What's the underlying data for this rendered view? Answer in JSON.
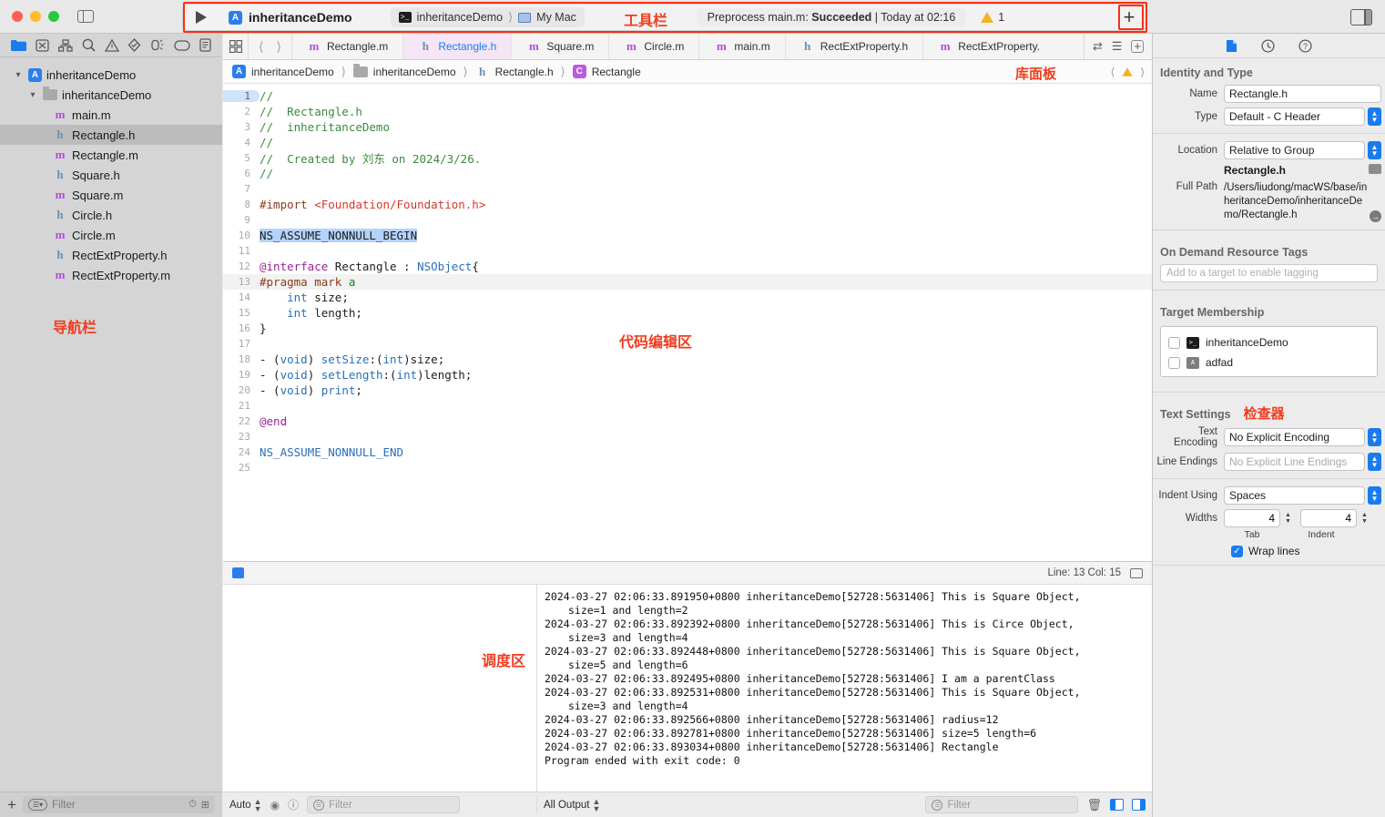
{
  "window": {
    "traffic_lights": [
      "close",
      "minimize",
      "zoom"
    ],
    "sidebar_toggle": "toggle-navigator"
  },
  "toolbar": {
    "run_button": "run",
    "scheme_name": "inheritanceDemo",
    "destination_project": "inheritanceDemo",
    "destination_device": "My Mac",
    "status_text_prefix": "Preprocess main.m: ",
    "status_result": "Succeeded",
    "status_text_suffix": " | Today at 02:16",
    "warning_count": "1",
    "add_button": "+",
    "annotation": "工具栏"
  },
  "navigator": {
    "tabs": [
      "project-navigator",
      "source-control-navigator",
      "hierarchy-navigator",
      "find-navigator",
      "issue-navigator",
      "test-navigator",
      "debug-navigator",
      "breakpoint-navigator",
      "report-navigator"
    ],
    "annotation": "导航栏",
    "tree": [
      {
        "label": "inheritanceDemo",
        "kind": "project",
        "depth": 0,
        "expanded": true,
        "selected": false
      },
      {
        "label": "inheritanceDemo",
        "kind": "folder",
        "depth": 1,
        "expanded": true,
        "selected": false
      },
      {
        "label": "main.m",
        "kind": "m",
        "depth": 2,
        "selected": false
      },
      {
        "label": "Rectangle.h",
        "kind": "h",
        "depth": 2,
        "selected": true
      },
      {
        "label": "Rectangle.m",
        "kind": "m",
        "depth": 2,
        "selected": false
      },
      {
        "label": "Square.h",
        "kind": "h",
        "depth": 2,
        "selected": false
      },
      {
        "label": "Square.m",
        "kind": "m",
        "depth": 2,
        "selected": false
      },
      {
        "label": "Circle.h",
        "kind": "h",
        "depth": 2,
        "selected": false
      },
      {
        "label": "Circle.m",
        "kind": "m",
        "depth": 2,
        "selected": false
      },
      {
        "label": "RectExtProperty.h",
        "kind": "h",
        "depth": 2,
        "selected": false
      },
      {
        "label": "RectExtProperty.m",
        "kind": "m",
        "depth": 2,
        "selected": false
      }
    ],
    "bottom": {
      "add_label": "+",
      "filter_placeholder": "Filter"
    }
  },
  "editor": {
    "tabs": [
      {
        "label": "Rectangle.m",
        "kind": "m",
        "active": false
      },
      {
        "label": "Rectangle.h",
        "kind": "h",
        "active": true
      },
      {
        "label": "Square.m",
        "kind": "m",
        "active": false
      },
      {
        "label": "Circle.m",
        "kind": "m",
        "active": false
      },
      {
        "label": "main.m",
        "kind": "m",
        "active": false
      },
      {
        "label": "RectExtProperty.h",
        "kind": "h",
        "active": false
      },
      {
        "label": "RectExtProperty.",
        "kind": "m",
        "active": false
      }
    ],
    "breadcrumb": [
      {
        "label": "inheritanceDemo",
        "kind": "project"
      },
      {
        "label": "inheritanceDemo",
        "kind": "folder"
      },
      {
        "label": "Rectangle.h",
        "kind": "h"
      },
      {
        "label": "Rectangle",
        "kind": "class"
      }
    ],
    "library_annotation": "库面板",
    "code_annotation": "代码编辑区",
    "lines": [
      {
        "n": "1",
        "cur": true,
        "html": "<span class='c-com'>//</span>"
      },
      {
        "n": "2",
        "html": "<span class='c-com'>//  Rectangle.h</span>"
      },
      {
        "n": "3",
        "html": "<span class='c-com'>//  inheritanceDemo</span>"
      },
      {
        "n": "4",
        "html": "<span class='c-com'>//</span>"
      },
      {
        "n": "5",
        "html": "<span class='c-com'>//  Created by 刘东 on 2024/3/26.</span>"
      },
      {
        "n": "6",
        "html": "<span class='c-com'>//</span>"
      },
      {
        "n": "7",
        "html": ""
      },
      {
        "n": "8",
        "html": "<span class='c-pre'>#import</span> <span class='c-str'>&lt;Foundation/Foundation.h&gt;</span>"
      },
      {
        "n": "9",
        "html": ""
      },
      {
        "n": "10",
        "html": "<span class='c-sel'>NS_ASSUME_NONNULL_BEGIN</span>"
      },
      {
        "n": "11",
        "html": ""
      },
      {
        "n": "12",
        "html": "<span class='c-kw'>@interface</span> Rectangle : <span class='c-type'>NSObject</span>{"
      },
      {
        "n": "13",
        "hl": true,
        "html": "<span class='c-pre'>#pragma mark</span> <span class='c-green'>a</span>"
      },
      {
        "n": "14",
        "html": "    <span class='c-type'>int</span> size;"
      },
      {
        "n": "15",
        "html": "    <span class='c-type'>int</span> length;"
      },
      {
        "n": "16",
        "html": "}"
      },
      {
        "n": "17",
        "html": ""
      },
      {
        "n": "18",
        "html": "- (<span class='c-type'>void</span>) <span class='c-fn'>setSize</span>:(<span class='c-type'>int</span>)size;"
      },
      {
        "n": "19",
        "html": "- (<span class='c-type'>void</span>) <span class='c-fn'>setLength</span>:(<span class='c-type'>int</span>)length;"
      },
      {
        "n": "20",
        "html": "- (<span class='c-type'>void</span>) <span class='c-fn'>print</span>;"
      },
      {
        "n": "21",
        "html": ""
      },
      {
        "n": "22",
        "html": "<span class='c-kw'>@end</span>"
      },
      {
        "n": "23",
        "html": ""
      },
      {
        "n": "24",
        "html": "<span class='c-mac'>NS_ASSUME_NONNULL_END</span>"
      },
      {
        "n": "25",
        "html": ""
      }
    ]
  },
  "console": {
    "line_col": "Line: 13  Col: 15",
    "annotation": "调度区",
    "output": [
      "2024-03-27 02:06:33.891950+0800 inheritanceDemo[52728:5631406] This is Square Object,",
      "    size=1 and length=2",
      "2024-03-27 02:06:33.892392+0800 inheritanceDemo[52728:5631406] This is Circe Object,",
      "    size=3 and length=4",
      "2024-03-27 02:06:33.892448+0800 inheritanceDemo[52728:5631406] This is Square Object,",
      "    size=5 and length=6",
      "2024-03-27 02:06:33.892495+0800 inheritanceDemo[52728:5631406] I am a parentClass",
      "2024-03-27 02:06:33.892531+0800 inheritanceDemo[52728:5631406] This is Square Object,",
      "    size=3 and length=4",
      "2024-03-27 02:06:33.892566+0800 inheritanceDemo[52728:5631406] radius=12",
      "2024-03-27 02:06:33.892781+0800 inheritanceDemo[52728:5631406] size=5 length=6",
      "2024-03-27 02:06:33.893034+0800 inheritanceDemo[52728:5631406] Rectangle",
      "Program ended with exit code: 0"
    ],
    "bottom": {
      "scope_popup": "Auto",
      "var_filter_placeholder": "Filter",
      "output_popup": "All Output",
      "output_filter_placeholder": "Filter"
    }
  },
  "inspector": {
    "tabs": [
      "file-inspector",
      "history-inspector",
      "quick-help-inspector"
    ],
    "annotation": "检查器",
    "identity": {
      "section_title": "Identity and Type",
      "name_label": "Name",
      "name_value": "Rectangle.h",
      "type_label": "Type",
      "type_value": "Default - C Header",
      "location_label": "Location",
      "location_value": "Relative to Group",
      "location_file": "Rectangle.h",
      "fullpath_label": "Full Path",
      "fullpath_value": "/Users/liudong/macWS/base/inheritanceDemo/inheritanceDemo/Rectangle.h"
    },
    "odr": {
      "section_title": "On Demand Resource Tags",
      "placeholder": "Add to a target to enable tagging"
    },
    "target_membership": {
      "section_title": "Target Membership",
      "items": [
        {
          "label": "inheritanceDemo",
          "checked": false,
          "icon": "terminal"
        },
        {
          "label": "adfad",
          "checked": false,
          "icon": "app"
        }
      ]
    },
    "text_settings": {
      "section_title": "Text Settings",
      "encoding_label": "Text Encoding",
      "encoding_value": "No Explicit Encoding",
      "endings_label": "Line Endings",
      "endings_value": "No Explicit Line Endings",
      "indent_label": "Indent Using",
      "indent_value": "Spaces",
      "widths_label": "Widths",
      "tab_value": "4",
      "indent_value_num": "4",
      "tab_sublabel": "Tab",
      "indent_sublabel": "Indent",
      "wrap_label": "Wrap lines",
      "wrap_checked": true
    }
  }
}
